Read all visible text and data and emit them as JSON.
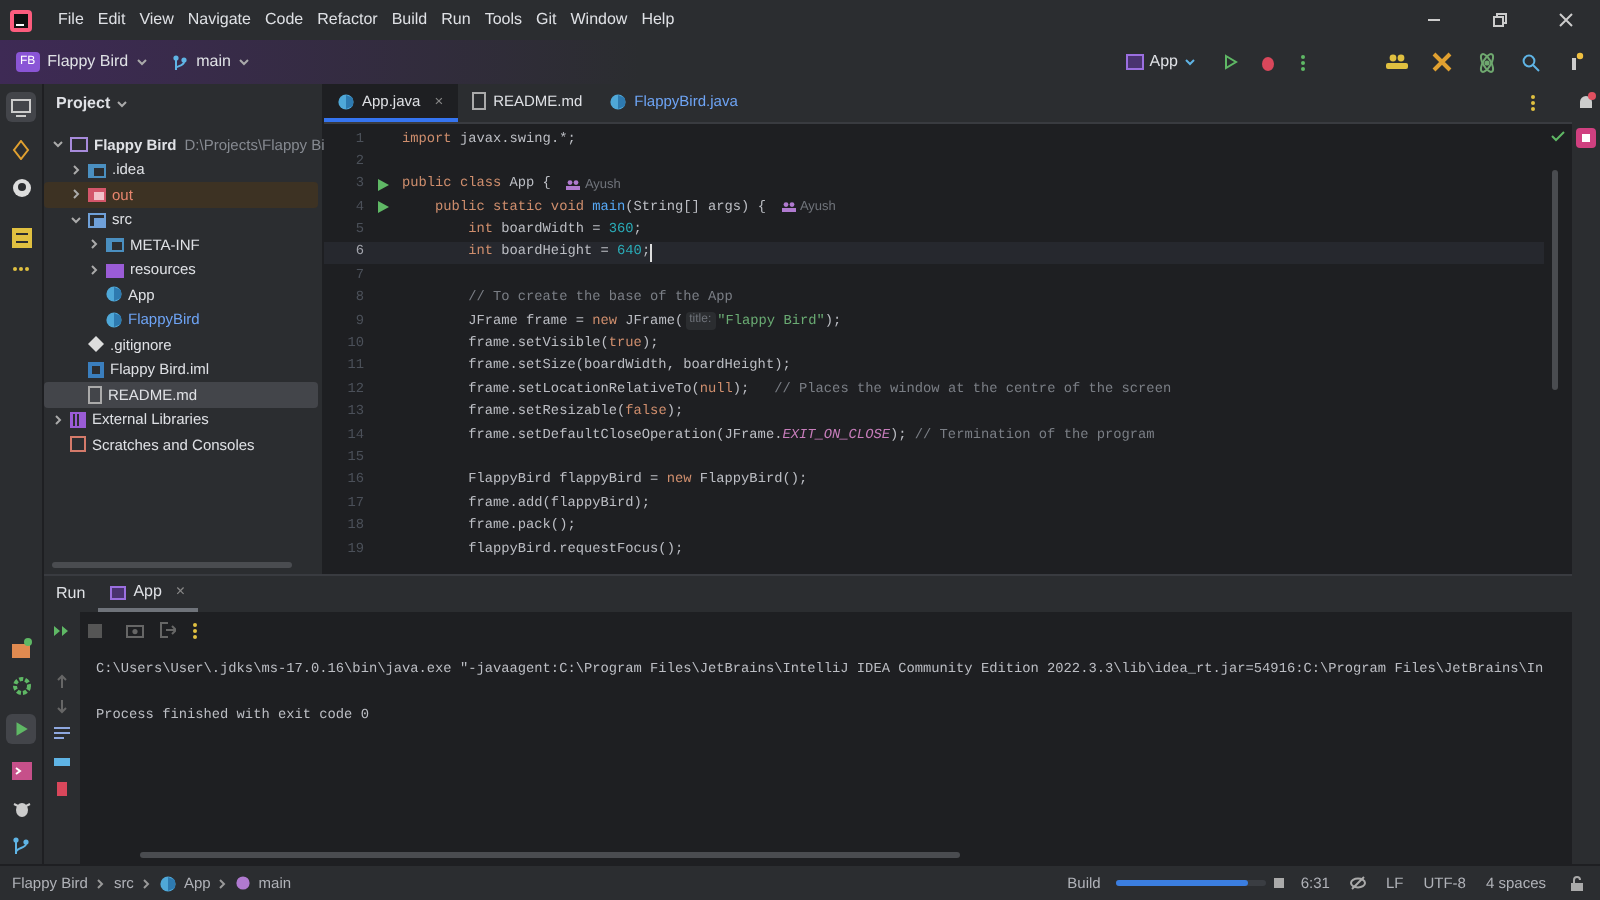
{
  "menu": [
    "File",
    "Edit",
    "View",
    "Navigate",
    "Code",
    "Refactor",
    "Build",
    "Run",
    "Tools",
    "Git",
    "Window",
    "Help"
  ],
  "toolbar": {
    "project": {
      "badge": "FB",
      "name": "Flappy Bird"
    },
    "branch": "main",
    "run_config": "App"
  },
  "project_panel": {
    "title": "Project",
    "tree": [
      {
        "label": "Flappy Bird",
        "path": "D:\\Projects\\Flappy Bi",
        "kind": "module",
        "expanded": true,
        "selected": false,
        "excluded": false,
        "color": "#dfe1e5",
        "children": [
          {
            "label": ".idea",
            "kind": "folder",
            "expanded": false,
            "selected": false,
            "excluded": false,
            "color": "#dfe1e5"
          },
          {
            "label": "out",
            "kind": "excluded-folder",
            "expanded": false,
            "selected": false,
            "excluded": true,
            "color": "#e8866e"
          },
          {
            "label": "src",
            "kind": "source-folder",
            "expanded": true,
            "selected": false,
            "excluded": false,
            "color": "#dfe1e5",
            "children": [
              {
                "label": "META-INF",
                "kind": "folder",
                "expanded": false,
                "selected": false,
                "excluded": false,
                "color": "#dfe1e5"
              },
              {
                "label": "resources",
                "kind": "resources-folder",
                "expanded": false,
                "selected": false,
                "excluded": false,
                "color": "#dfe1e5"
              },
              {
                "label": "App",
                "kind": "class",
                "selected": false,
                "excluded": false,
                "color": "#dfe1e5"
              },
              {
                "label": "FlappyBird",
                "kind": "class",
                "selected": false,
                "excluded": false,
                "color": "#6ea4f5"
              }
            ]
          },
          {
            "label": ".gitignore",
            "kind": "gitignore",
            "selected": false,
            "excluded": false,
            "color": "#dfe1e5"
          },
          {
            "label": "Flappy Bird.iml",
            "kind": "iml",
            "selected": false,
            "excluded": false,
            "color": "#dfe1e5"
          },
          {
            "label": "README.md",
            "kind": "markdown",
            "selected": true,
            "excluded": false,
            "color": "#dfe1e5"
          }
        ]
      },
      {
        "label": "External Libraries",
        "kind": "libraries",
        "expanded": false,
        "selected": false,
        "excluded": false,
        "color": "#dfe1e5"
      },
      {
        "label": "Scratches and Consoles",
        "kind": "scratches",
        "selected": false,
        "excluded": false,
        "color": "#dfe1e5"
      }
    ]
  },
  "editor_tabs": [
    {
      "label": "App.java",
      "kind": "class",
      "selected": true,
      "close": "×",
      "color": "#dfe1e5"
    },
    {
      "label": "README.md",
      "kind": "markdown",
      "selected": false,
      "color": "#dfe1e5"
    },
    {
      "label": "FlappyBird.java",
      "kind": "class",
      "selected": false,
      "color": "#6ea4f5"
    }
  ],
  "code_lines": [
    {
      "number": "1",
      "current": false,
      "run_marker": false,
      "tokens": [
        {
          "kind": "keyword",
          "text": "import "
        },
        {
          "kind": "plain",
          "text": "javax.swing.*;"
        }
      ]
    },
    {
      "number": "2",
      "current": false,
      "run_marker": false
    },
    {
      "number": "3",
      "current": false,
      "run_marker": true,
      "tokens": [
        {
          "kind": "keyword",
          "text": "public class "
        },
        {
          "kind": "plain",
          "text": "App {"
        },
        {
          "kind": "author",
          "text": "Ayush"
        }
      ]
    },
    {
      "number": "4",
      "current": false,
      "run_marker": true,
      "tokens": [
        {
          "kind": "keyword",
          "text": "    public static void "
        },
        {
          "kind": "method",
          "text": "main"
        },
        {
          "kind": "plain",
          "text": "(String[] args) {"
        },
        {
          "kind": "author",
          "text": "Ayush"
        }
      ]
    },
    {
      "number": "5",
      "current": false,
      "run_marker": false,
      "tokens": [
        {
          "kind": "keyword",
          "text": "        int "
        },
        {
          "kind": "plain",
          "text": "boardWidth = "
        },
        {
          "kind": "number",
          "text": "360"
        },
        {
          "kind": "plain",
          "text": ";"
        }
      ]
    },
    {
      "number": "6",
      "current": true,
      "run_marker": false,
      "tokens": [
        {
          "kind": "keyword",
          "text": "        int "
        },
        {
          "kind": "plain",
          "text": "boardHeight = "
        },
        {
          "kind": "number",
          "text": "640"
        },
        {
          "kind": "plain",
          "text": ";"
        }
      ]
    },
    {
      "number": "7",
      "current": false,
      "run_marker": false
    },
    {
      "number": "8",
      "current": false,
      "run_marker": false,
      "tokens": [
        {
          "kind": "comment",
          "text": "        // To create the base of the App"
        }
      ]
    },
    {
      "number": "9",
      "current": false,
      "run_marker": false,
      "tokens": [
        {
          "kind": "plain",
          "text": "        JFrame frame = "
        },
        {
          "kind": "keyword",
          "text": "new "
        },
        {
          "kind": "plain",
          "text": "JFrame("
        },
        {
          "kind": "hint",
          "text": "title:"
        },
        {
          "kind": "string",
          "text": "\"Flappy Bird\""
        },
        {
          "kind": "plain",
          "text": ");"
        }
      ]
    },
    {
      "number": "10",
      "current": false,
      "run_marker": false,
      "tokens": [
        {
          "kind": "plain",
          "text": "        frame.setVisible("
        },
        {
          "kind": "keyword",
          "text": "true"
        },
        {
          "kind": "plain",
          "text": ");"
        }
      ]
    },
    {
      "number": "11",
      "current": false,
      "run_marker": false,
      "tokens": [
        {
          "kind": "plain",
          "text": "        frame.setSize(boardWidth, boardHeight);"
        }
      ]
    },
    {
      "number": "12",
      "current": false,
      "run_marker": false,
      "tokens": [
        {
          "kind": "plain",
          "text": "        frame.setLocationRelativeTo("
        },
        {
          "kind": "keyword",
          "text": "null"
        },
        {
          "kind": "plain",
          "text": ");   "
        },
        {
          "kind": "comment",
          "text": "// Places the window at the centre of the screen"
        }
      ]
    },
    {
      "number": "13",
      "current": false,
      "run_marker": false,
      "tokens": [
        {
          "kind": "plain",
          "text": "        frame.setResizable("
        },
        {
          "kind": "keyword",
          "text": "false"
        },
        {
          "kind": "plain",
          "text": ");"
        }
      ]
    },
    {
      "number": "14",
      "current": false,
      "run_marker": false,
      "tokens": [
        {
          "kind": "plain",
          "text": "        frame.setDefaultCloseOperation(JFrame."
        },
        {
          "kind": "constant",
          "text": "EXIT_ON_CLOSE"
        },
        {
          "kind": "plain",
          "text": "); "
        },
        {
          "kind": "comment",
          "text": "// Termination of the program"
        }
      ]
    },
    {
      "number": "15",
      "current": false,
      "run_marker": false
    },
    {
      "number": "16",
      "current": false,
      "run_marker": false,
      "tokens": [
        {
          "kind": "plain",
          "text": "        FlappyBird flappyBird = "
        },
        {
          "kind": "keyword",
          "text": "new "
        },
        {
          "kind": "plain",
          "text": "FlappyBird();"
        }
      ]
    },
    {
      "number": "17",
      "current": false,
      "run_marker": false,
      "tokens": [
        {
          "kind": "plain",
          "text": "        frame.add(flappyBird);"
        }
      ]
    },
    {
      "number": "18",
      "current": false,
      "run_marker": false,
      "tokens": [
        {
          "kind": "plain",
          "text": "        frame.pack();"
        }
      ]
    },
    {
      "number": "19",
      "current": false,
      "run_marker": false,
      "tokens": [
        {
          "kind": "plain",
          "text": "        flappyBird.requestFocus();"
        }
      ]
    }
  ],
  "run_panel": {
    "title": "Run",
    "tabs": [
      {
        "label": "App",
        "selected": true,
        "close": "×"
      }
    ],
    "console": [
      "C:\\Users\\User\\.jdks\\ms-17.0.16\\bin\\java.exe \"-javaagent:C:\\Program Files\\JetBrains\\IntelliJ IDEA Community Edition 2022.3.3\\lib\\idea_rt.jar=54916:C:\\Program Files\\JetBrains\\In",
      "Process finished with exit code 0"
    ]
  },
  "status_bar": {
    "breadcrumbs": [
      "Flappy Bird",
      "src",
      "App",
      "main"
    ],
    "build": {
      "label": "Build",
      "level": 0.88
    },
    "position": "6:31",
    "line_separator": "LF",
    "encoding": "UTF-8",
    "indent": "4 spaces"
  }
}
